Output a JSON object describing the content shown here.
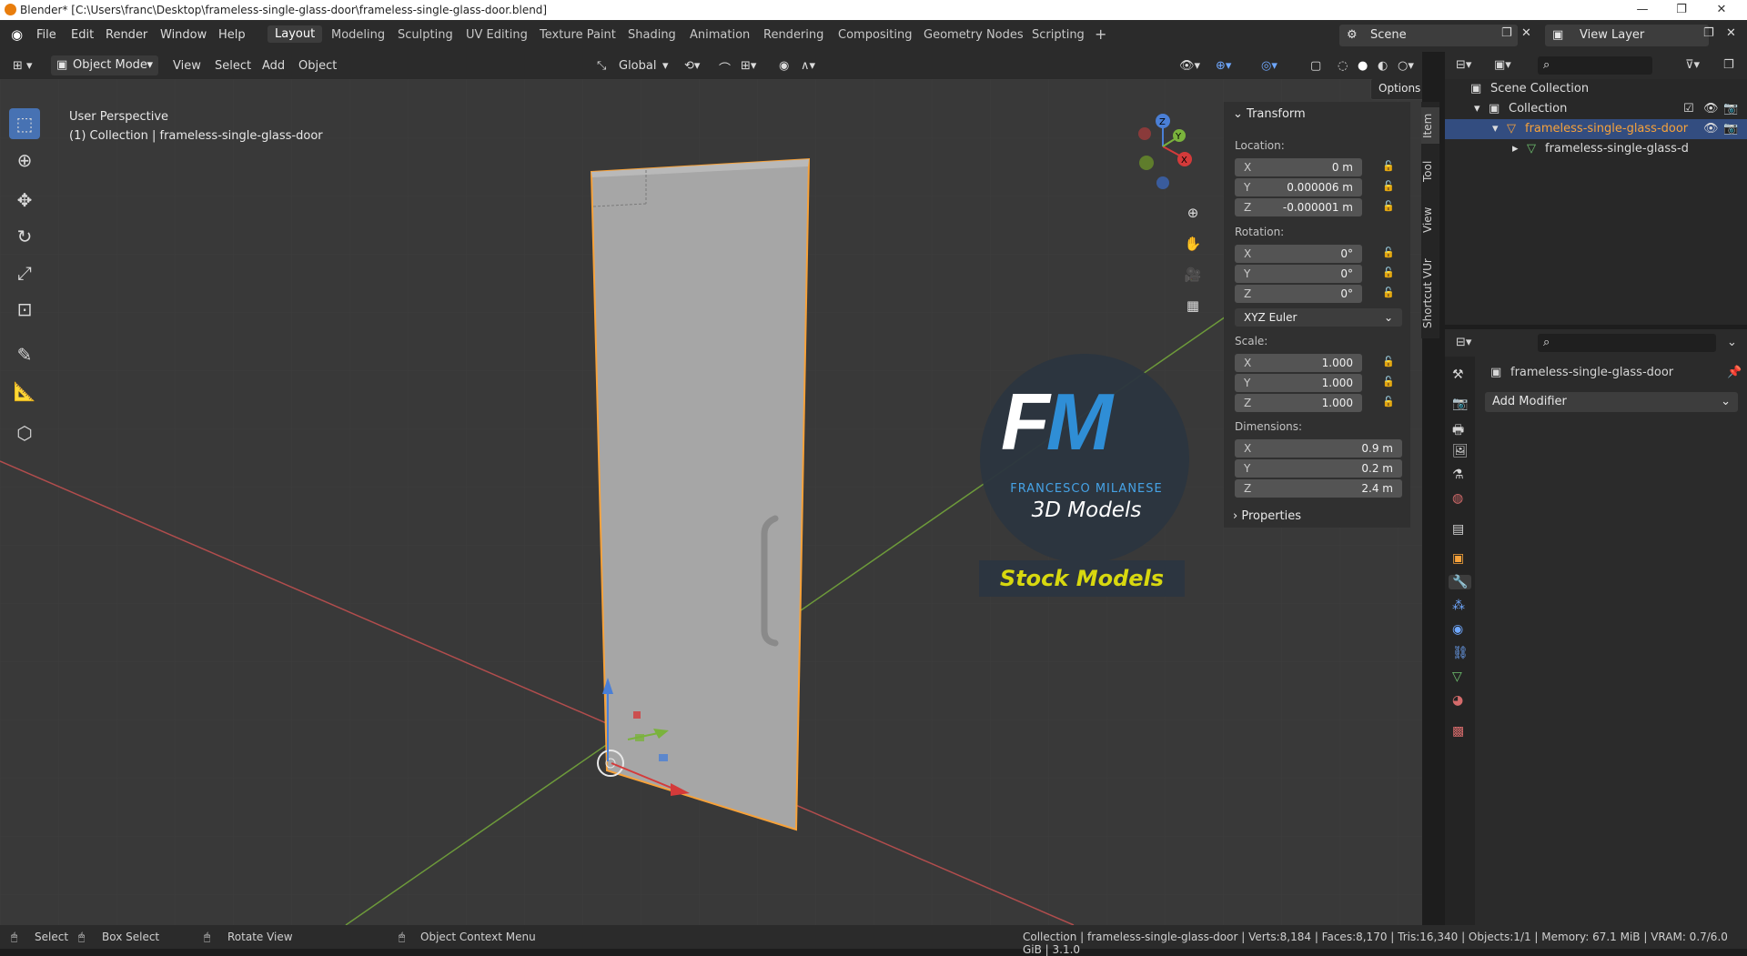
{
  "titlebar": {
    "title": "Blender* [C:\\Users\\franc\\Desktop\\frameless-single-glass-door\\frameless-single-glass-door.blend]"
  },
  "menu": {
    "file": "File",
    "edit": "Edit",
    "render": "Render",
    "window": "Window",
    "help": "Help"
  },
  "workspaces": [
    "Layout",
    "Modeling",
    "Sculpting",
    "UV Editing",
    "Texture Paint",
    "Shading",
    "Animation",
    "Rendering",
    "Compositing",
    "Geometry Nodes",
    "Scripting"
  ],
  "scene": {
    "label": "Scene",
    "view_layer": "View Layer"
  },
  "header": {
    "mode": "Object Mode",
    "view": "View",
    "select": "Select",
    "add": "Add",
    "object": "Object",
    "transform_orientation": "Global",
    "options": "Options"
  },
  "viewport": {
    "perspective": "User Perspective",
    "collection_info": "(1) Collection | frameless-single-glass-door"
  },
  "watermark": {
    "initials": "FM",
    "author": "FRANCESCO MILANESE",
    "subtitle": "3D Models",
    "banner": "Stock Models"
  },
  "npanel": {
    "section_title": "Transform",
    "location_label": "Location:",
    "location": {
      "x": "0 m",
      "y": "0.000006 m",
      "z": "-0.000001 m"
    },
    "rotation_label": "Rotation:",
    "rotation": {
      "x": "0°",
      "y": "0°",
      "z": "0°"
    },
    "rotation_mode": "XYZ Euler",
    "scale_label": "Scale:",
    "scale": {
      "x": "1.000",
      "y": "1.000",
      "z": "1.000"
    },
    "dimensions_label": "Dimensions:",
    "dimensions": {
      "x": "0.9 m",
      "y": "0.2 m",
      "z": "2.4 m"
    },
    "properties": "Properties",
    "axis": {
      "x": "X",
      "y": "Y",
      "z": "Z"
    }
  },
  "vertical_tabs": {
    "item": "Item",
    "tool": "Tool",
    "view": "View",
    "shortcut": "Shortcut VUr"
  },
  "outliner": {
    "scene_collection": "Scene Collection",
    "collection": "Collection",
    "object": "frameless-single-glass-door",
    "mesh": "frameless-single-glass-d"
  },
  "properties": {
    "object_name": "frameless-single-glass-door",
    "add_modifier": "Add Modifier"
  },
  "statusbar": {
    "select": "Select",
    "box_select": "Box Select",
    "rotate_view": "Rotate View",
    "context_menu": "Object Context Menu",
    "stats": "Collection | frameless-single-glass-door | Verts:8,184 | Faces:8,170 | Tris:16,340 | Objects:1/1 | Memory: 67.1 MiB | VRAM: 0.7/6.0 GiB | 3.1.0"
  },
  "colors": {
    "accent": "#4772b3",
    "selection": "#f7a23a",
    "watermark_text": "#d8d80f"
  }
}
